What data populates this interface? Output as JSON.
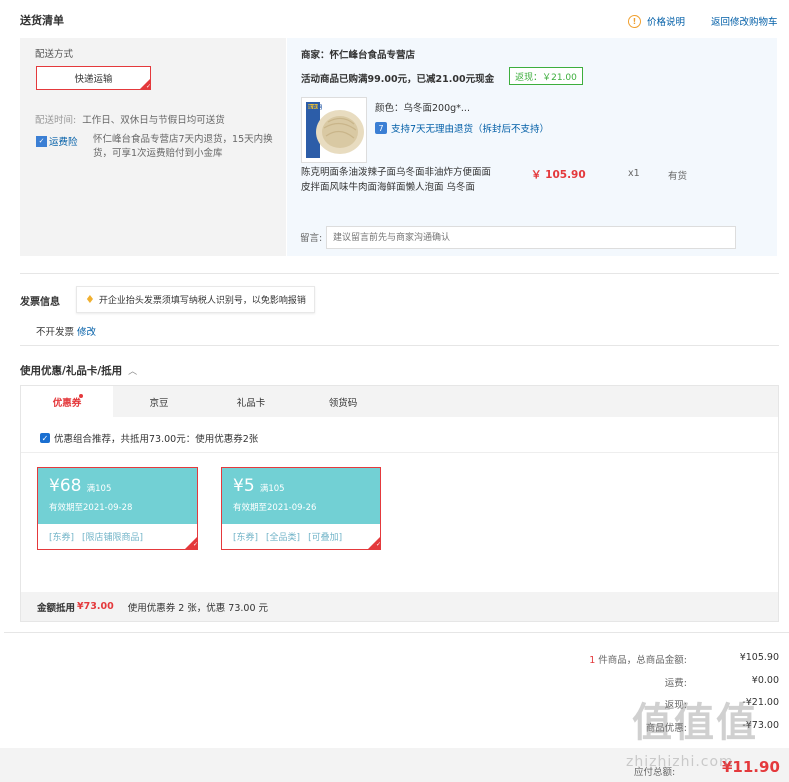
{
  "header": {
    "title": "送货清单",
    "price_explain": "价格说明",
    "back_to_cart": "返回修改购物车"
  },
  "delivery": {
    "method_label": "配送方式",
    "method_selected": "快递运输",
    "time_label": "配送时间:",
    "time_value": "工作日、双休日与节假日均可送货",
    "insurance_label": "运费险",
    "insurance_text": "怀仁峰台食品专营店7天内退货，15天内换货，可享1次运费赔付到小金库"
  },
  "shop": {
    "name": "商家：怀仁峰台食品专营店",
    "promo": "活动商品已购满99.00元，已减21.00元现金",
    "rebate": "返现：￥21.00",
    "product": {
      "color_spec": "颜色：乌冬面200g*...",
      "return_policy": "支持7天无理由退货（拆封后不支持）",
      "name": "陈克明面条油泼辣子面乌冬面非油炸方便面面皮拌面风味牛肉面海鲜面懒人泡面 乌冬面",
      "price": "￥ 105.90",
      "qty": "x1",
      "stock": "有货",
      "image_logo": "陈克明"
    },
    "note_label": "留言:",
    "note_placeholder": "建议留言前先与商家沟通确认"
  },
  "invoice": {
    "title": "发票信息",
    "tip": "开企业抬头发票须填写纳税人识别号，以免影响报销",
    "status": "不开发票",
    "modify": "修改"
  },
  "coupons": {
    "title": "使用优惠/礼品卡/抵用",
    "tabs": [
      "优惠券",
      "京豆",
      "礼品卡",
      "领货码"
    ],
    "combo_text": "优惠组合推荐，共抵用73.00元：使用优惠券2张",
    "items": [
      {
        "amount": "¥68",
        "cond": "满105",
        "valid": "有效期至2021-09-28",
        "tags": [
          "[东券]",
          "[限店铺限商品]"
        ]
      },
      {
        "amount": "¥5",
        "cond": "满105",
        "valid": "有效期至2021-09-26",
        "tags": [
          "[东券]",
          "[全品类]",
          "[可叠加]"
        ]
      }
    ],
    "amount_label": "金额抵用",
    "amount_value": "¥73.00",
    "amount_desc": "使用优惠券 2 张，优惠 73.00 元"
  },
  "summary": {
    "count": "1",
    "count_suffix": "件商品，总商品金额:",
    "total_goods": "¥105.90",
    "shipping_label": "运费:",
    "shipping": "¥0.00",
    "cashback_label": "返现:",
    "cashback": "-¥21.00",
    "discount_label": "商品优惠:",
    "discount": "-¥73.00",
    "payable_label": "应付总额:",
    "payable": "¥11.90"
  },
  "watermark": {
    "text": "值值值",
    "url": "zhizhizhi.com"
  },
  "colors": {
    "accent_red": "#e4393c",
    "link_blue": "#005ea7",
    "coupon_teal": "#72d0d4",
    "rebate_green": "#3dae3d"
  }
}
